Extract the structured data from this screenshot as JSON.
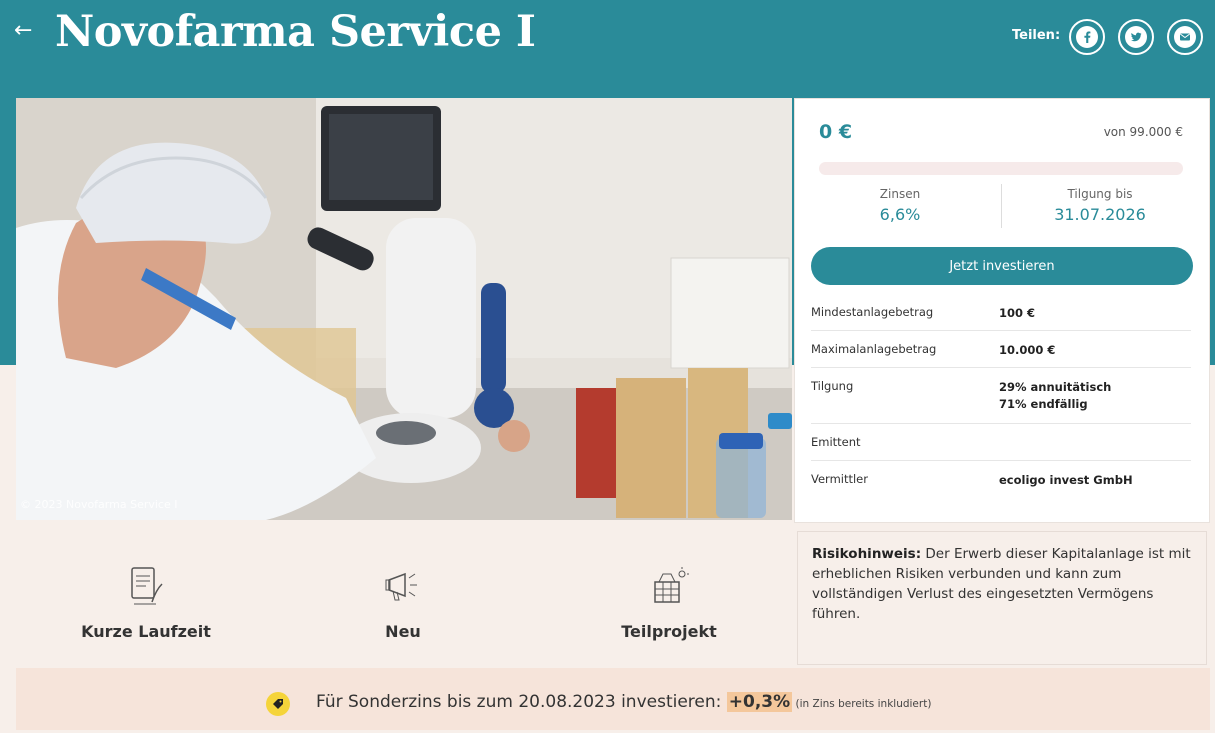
{
  "header": {
    "back_glyph": "←",
    "title": "Novofarma Service I",
    "share_label": "Teilen:",
    "share_icons": [
      "facebook-icon",
      "twitter-icon",
      "email-icon"
    ]
  },
  "photo": {
    "credit": "© 2023 Novofarma Service I"
  },
  "investment": {
    "amount": "0 €",
    "of_total": "von 99.000 €",
    "progress": 0,
    "interest_label": "Zinsen",
    "interest_value": "6,6%",
    "repayment_label": "Tilgung bis",
    "repayment_value": "31.07.2026",
    "cta_label": "Jetzt investieren"
  },
  "details": [
    {
      "key": "Mindestanlagebetrag",
      "value": "100 €"
    },
    {
      "key": "Maximalanlagebetrag",
      "value": "10.000 €"
    },
    {
      "key": "Tilgung",
      "value": "29% annuitätisch\n71% endfällig"
    },
    {
      "key": "Emittent",
      "value": ""
    },
    {
      "key": "Vermittler",
      "value": "ecoligo invest GmbH"
    }
  ],
  "features": [
    {
      "label": "Kurze Laufzeit",
      "icon": "document-signature-icon"
    },
    {
      "label": "Neu",
      "icon": "megaphone-icon"
    },
    {
      "label": "Teilprojekt",
      "icon": "solar-building-icon"
    }
  ],
  "risk": {
    "label": "Risikohinweis:",
    "text": " Der Erwerb dieser Kapitalanlage ist mit erheblichen Risiken verbunden und kann zum vollständigen Verlust des eingesetzten Vermögens führen."
  },
  "promo": {
    "text": "Für Sonderzins bis zum 20.08.2023 investieren: ",
    "highlight": "+0,3%",
    "note": " (in Zins bereits inkludiert)"
  },
  "colors": {
    "teal": "#2a8b99",
    "cream": "#f7efea",
    "promo_bg": "#f6e4da",
    "highlight": "#f4c79b",
    "badge_yellow": "#f5d43a"
  }
}
